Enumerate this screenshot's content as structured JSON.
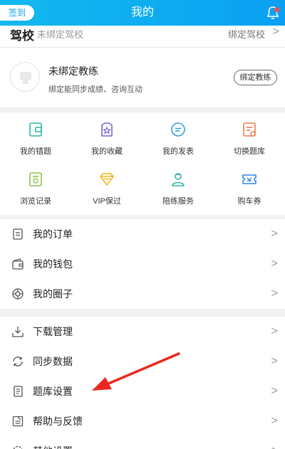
{
  "header": {
    "checkin_label": "签到",
    "title": "我的",
    "bell_icon": "bell-icon",
    "accent": "#0aa4ee",
    "badge_color": "#ff4d4d"
  },
  "school": {
    "label": "驾校",
    "status": "未绑定驾校",
    "bind_label": "绑定驾校",
    "chevron": ">"
  },
  "coach": {
    "name": "未绑定教练",
    "desc": "绑定能同步成绩、咨询互动",
    "bind_label": "绑定教练"
  },
  "grid": [
    {
      "label": "我的错题",
      "icon": "wrong-questions-icon",
      "color": "#2fb7a6"
    },
    {
      "label": "我的收藏",
      "icon": "favorites-icon",
      "color": "#7b63d8"
    },
    {
      "label": "我的发表",
      "icon": "posts-icon",
      "color": "#2f9ee8"
    },
    {
      "label": "切换题库",
      "icon": "switch-bank-icon",
      "color": "#ef7a4a"
    },
    {
      "label": "浏览记录",
      "icon": "history-icon",
      "color": "#8bc34a"
    },
    {
      "label": "VIP保过",
      "icon": "vip-icon",
      "color": "#f3b51b"
    },
    {
      "label": "陪练服务",
      "icon": "practice-service-icon",
      "color": "#2fb7a6"
    },
    {
      "label": "购车券",
      "icon": "car-coupon-icon",
      "color": "#2f86e8"
    }
  ],
  "menu1": [
    {
      "label": "我的订单",
      "icon": "order-icon",
      "chevron": ">"
    },
    {
      "label": "我的钱包",
      "icon": "wallet-icon",
      "chevron": ">"
    },
    {
      "label": "我的圈子",
      "icon": "circle-icon",
      "chevron": ">"
    }
  ],
  "menu2": [
    {
      "label": "下载管理",
      "icon": "download-icon",
      "chevron": ">"
    },
    {
      "label": "同步数据",
      "icon": "sync-icon",
      "chevron": ">"
    },
    {
      "label": "题库设置",
      "icon": "bank-settings-icon",
      "chevron": ">"
    },
    {
      "label": "帮助与反馈",
      "icon": "help-feedback-icon",
      "chevron": ">"
    },
    {
      "label": "其他设置",
      "icon": "settings-icon",
      "chevron": ">"
    }
  ],
  "annotation": {
    "color": "#e8281e",
    "icon": "red-arrow-icon"
  }
}
